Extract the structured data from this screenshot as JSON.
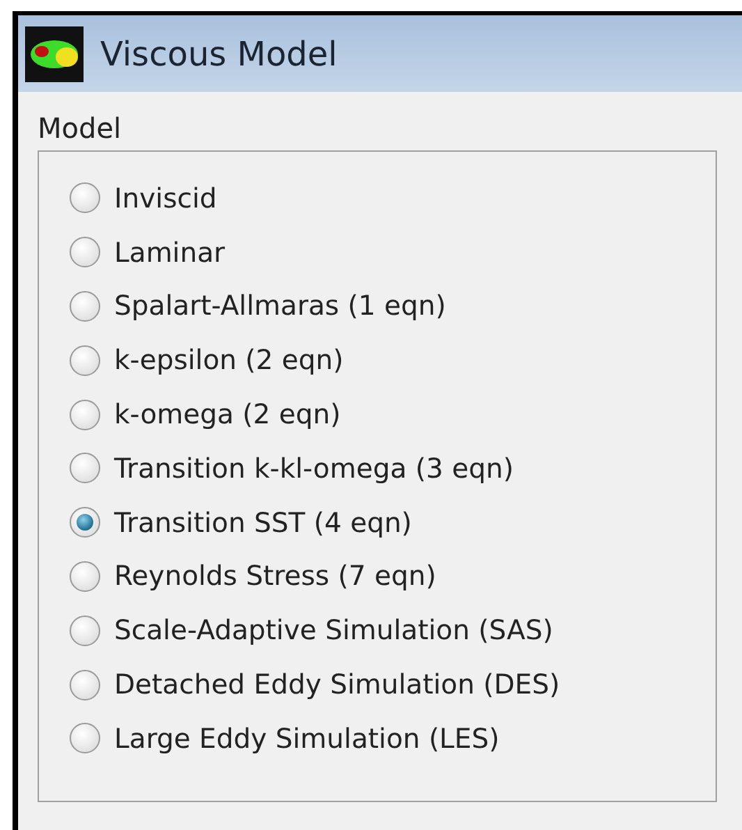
{
  "window": {
    "title": "Viscous Model"
  },
  "model": {
    "label": "Model",
    "options": [
      {
        "label": "Inviscid",
        "selected": false
      },
      {
        "label": "Laminar",
        "selected": false
      },
      {
        "label": "Spalart-Allmaras (1 eqn)",
        "selected": false
      },
      {
        "label": "k-epsilon (2 eqn)",
        "selected": false
      },
      {
        "label": "k-omega (2 eqn)",
        "selected": false
      },
      {
        "label": "Transition k-kl-omega (3 eqn)",
        "selected": false
      },
      {
        "label": "Transition SST (4 eqn)",
        "selected": true
      },
      {
        "label": "Reynolds Stress (7 eqn)",
        "selected": false
      },
      {
        "label": "Scale-Adaptive Simulation (SAS)",
        "selected": false
      },
      {
        "label": "Detached Eddy Simulation (DES)",
        "selected": false
      },
      {
        "label": "Large Eddy Simulation (LES)",
        "selected": false
      }
    ]
  }
}
